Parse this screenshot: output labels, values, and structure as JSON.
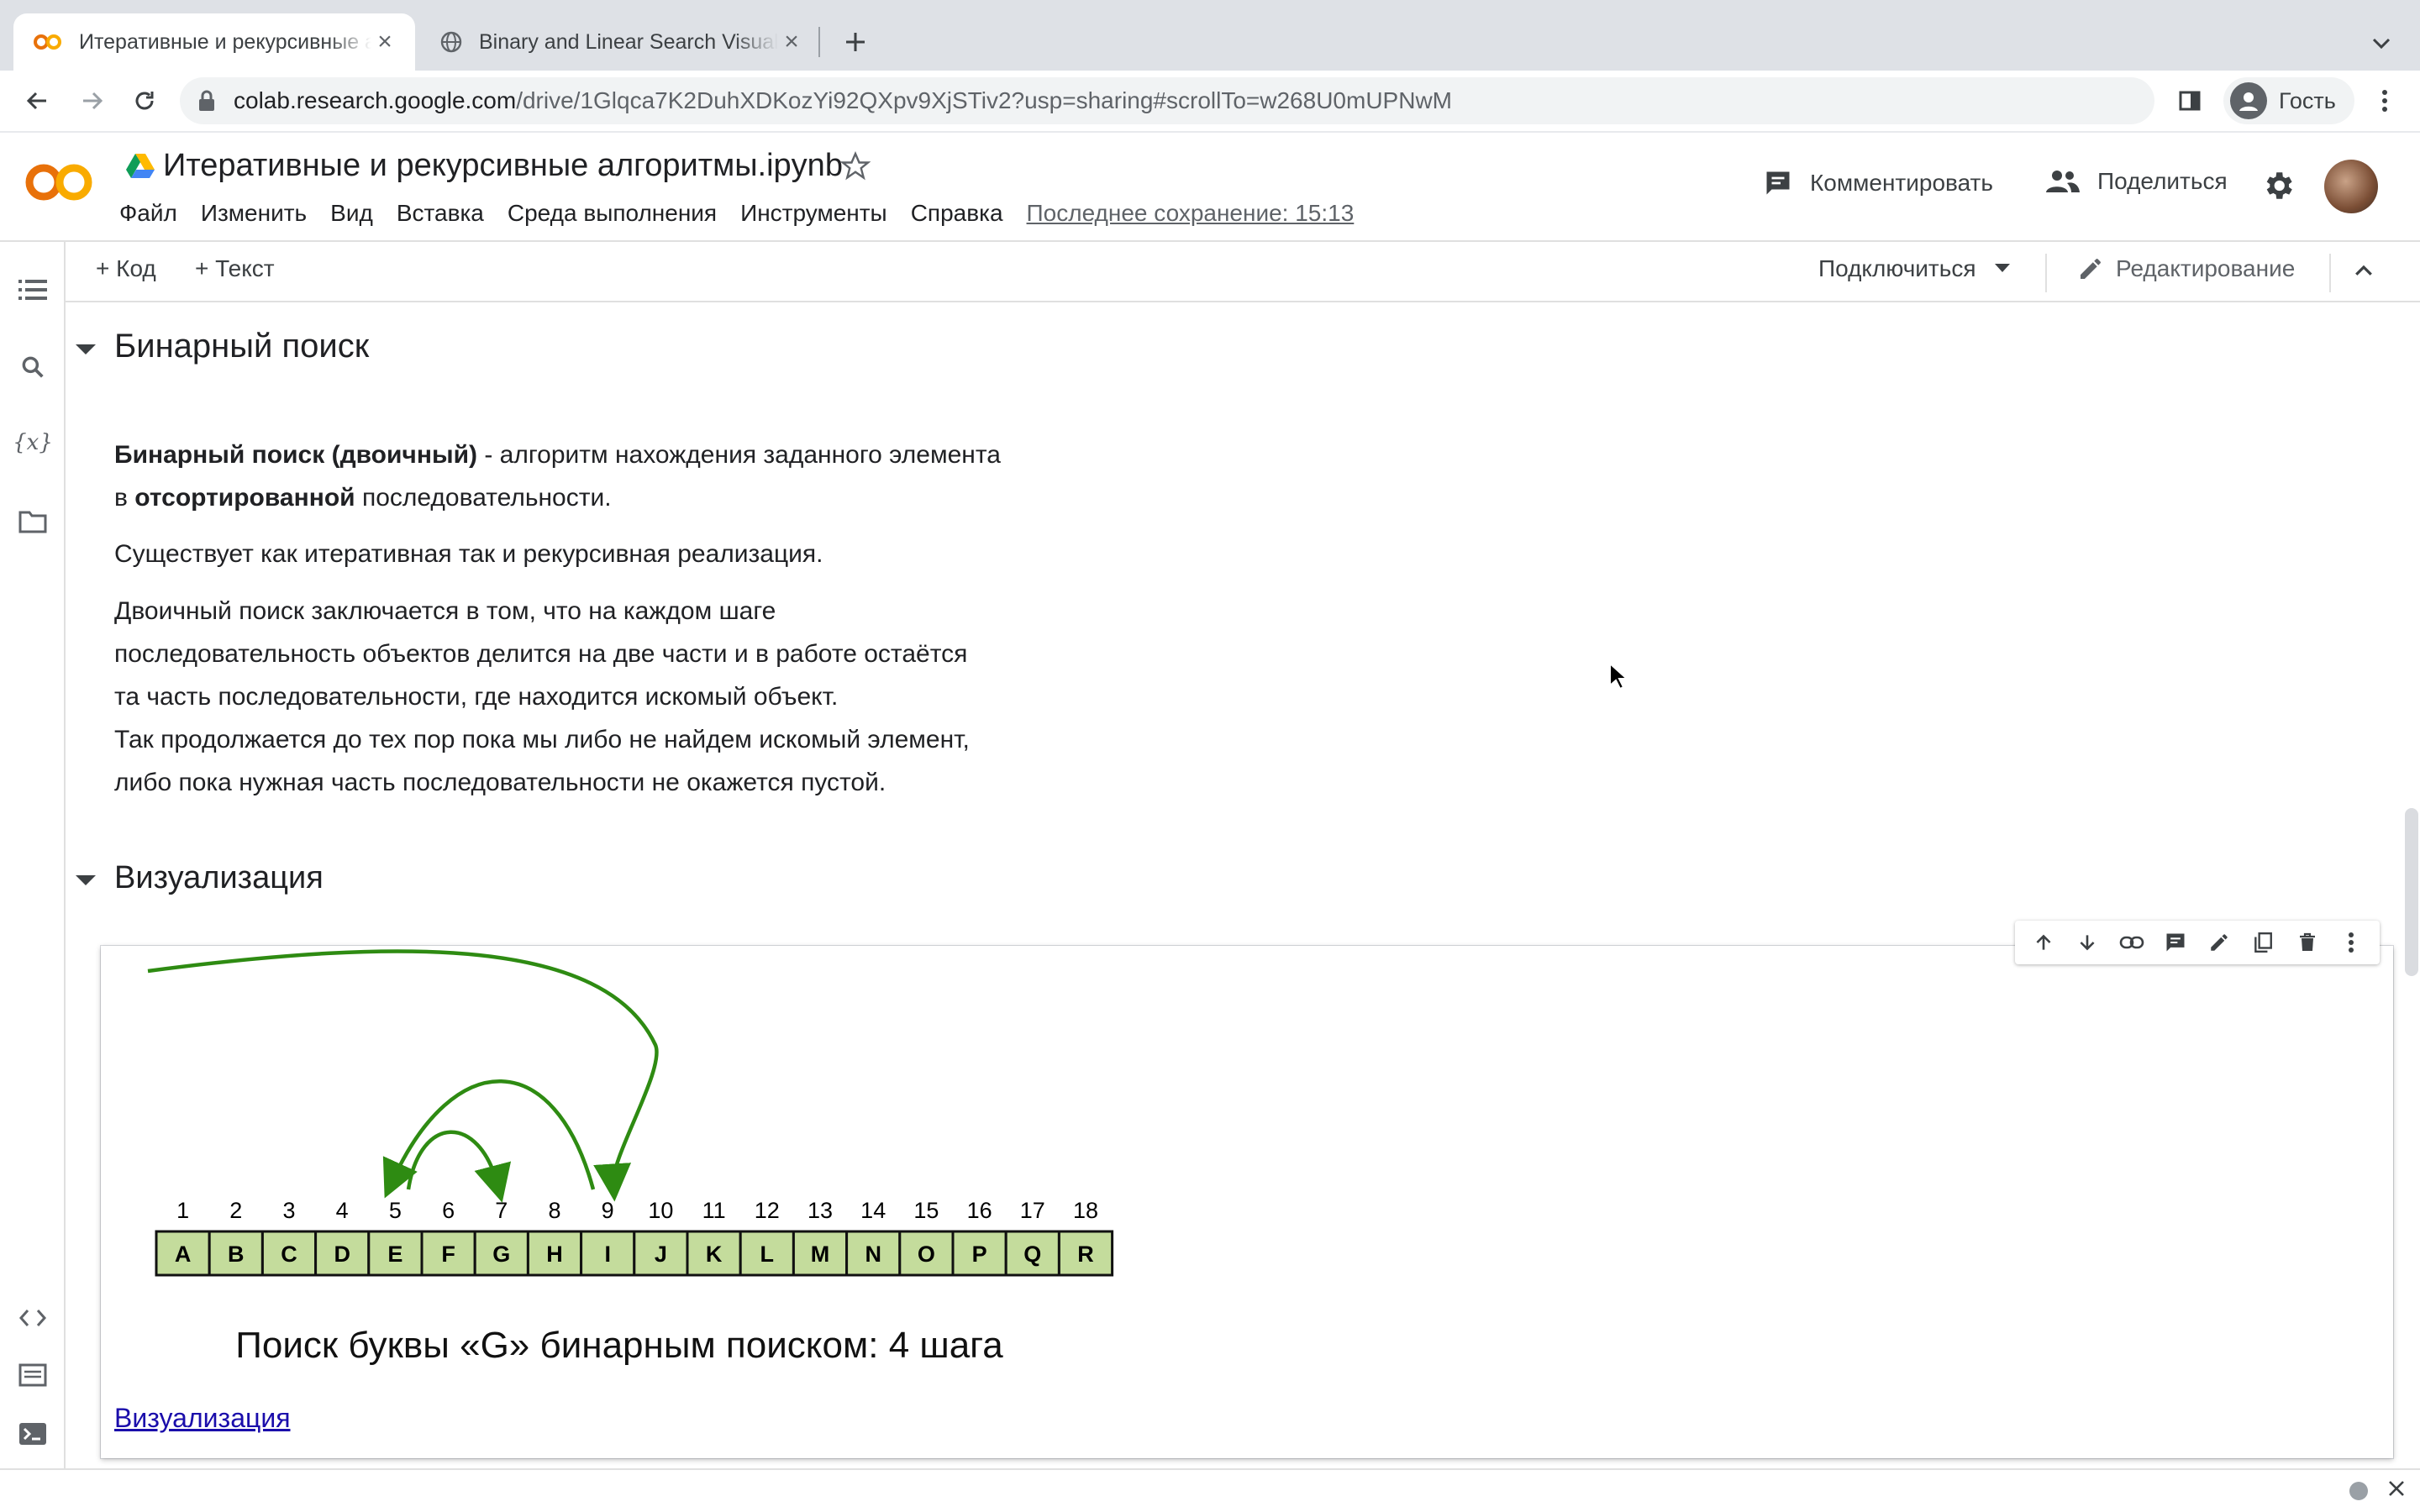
{
  "browser": {
    "tabs": [
      {
        "title": "Итеративные и рекурсивные алгоритмы.ipynb",
        "active": true
      },
      {
        "title": "Binary and Linear Search Visualization",
        "active": false
      }
    ],
    "url_host": "colab.research.google.com",
    "url_rest": "/drive/1Glqca7K2DuhXDKozYi92QXpv9XjSTiv2?usp=sharing#scrollTo=w268U0mUPNwM",
    "profile_label": "Гость"
  },
  "colab": {
    "logo_text": "CO",
    "notebook_title": "Итеративные и рекурсивные алгоритмы.ipynb",
    "menu": [
      "Файл",
      "Изменить",
      "Вид",
      "Вставка",
      "Среда выполнения",
      "Инструменты",
      "Справка"
    ],
    "last_save": "Последнее сохранение: 15:13",
    "comment_label": "Комментировать",
    "share_label": "Поделиться",
    "add_code": "+ Код",
    "add_text": "+ Текст",
    "connect_label": "Подключиться",
    "edit_label": "Редактирование"
  },
  "notebook": {
    "section1_title": "Бинарный поиск",
    "p1_bold": "Бинарный поиск (двоичный)",
    "p1_rest": " - алгоритм нахождения заданного элемента",
    "p1_line2_pre": "в ",
    "p1_line2_bold": "отсортированной",
    "p1_line2_post": " последовательности.",
    "p2": "Существует как итеративная так и рекурсивная реализация.",
    "p3_lines": [
      "Двоичный поиск заключается в том, что на каждом шаге",
      "последовательность объектов делится на две части и в работе остаётся",
      "та часть последовательности, где находится искомый объект.",
      "Так продолжается до тех пор пока мы либо не найдем искомый элемент,",
      "либо пока нужная часть последовательности не окажется пустой."
    ],
    "section2_title": "Визуализация",
    "diagram": {
      "indices": [
        "1",
        "2",
        "3",
        "4",
        "5",
        "6",
        "7",
        "8",
        "9",
        "10",
        "11",
        "12",
        "13",
        "14",
        "15",
        "16",
        "17",
        "18"
      ],
      "letters": [
        "A",
        "B",
        "C",
        "D",
        "E",
        "F",
        "G",
        "H",
        "I",
        "J",
        "K",
        "L",
        "M",
        "N",
        "O",
        "P",
        "Q",
        "R"
      ],
      "caption": "Поиск буквы «G» бинарным поиском: 4 шага",
      "box_color": "#c4dc9c",
      "arrow_color": "#2e8b12"
    },
    "link_text": "Визуализация"
  }
}
